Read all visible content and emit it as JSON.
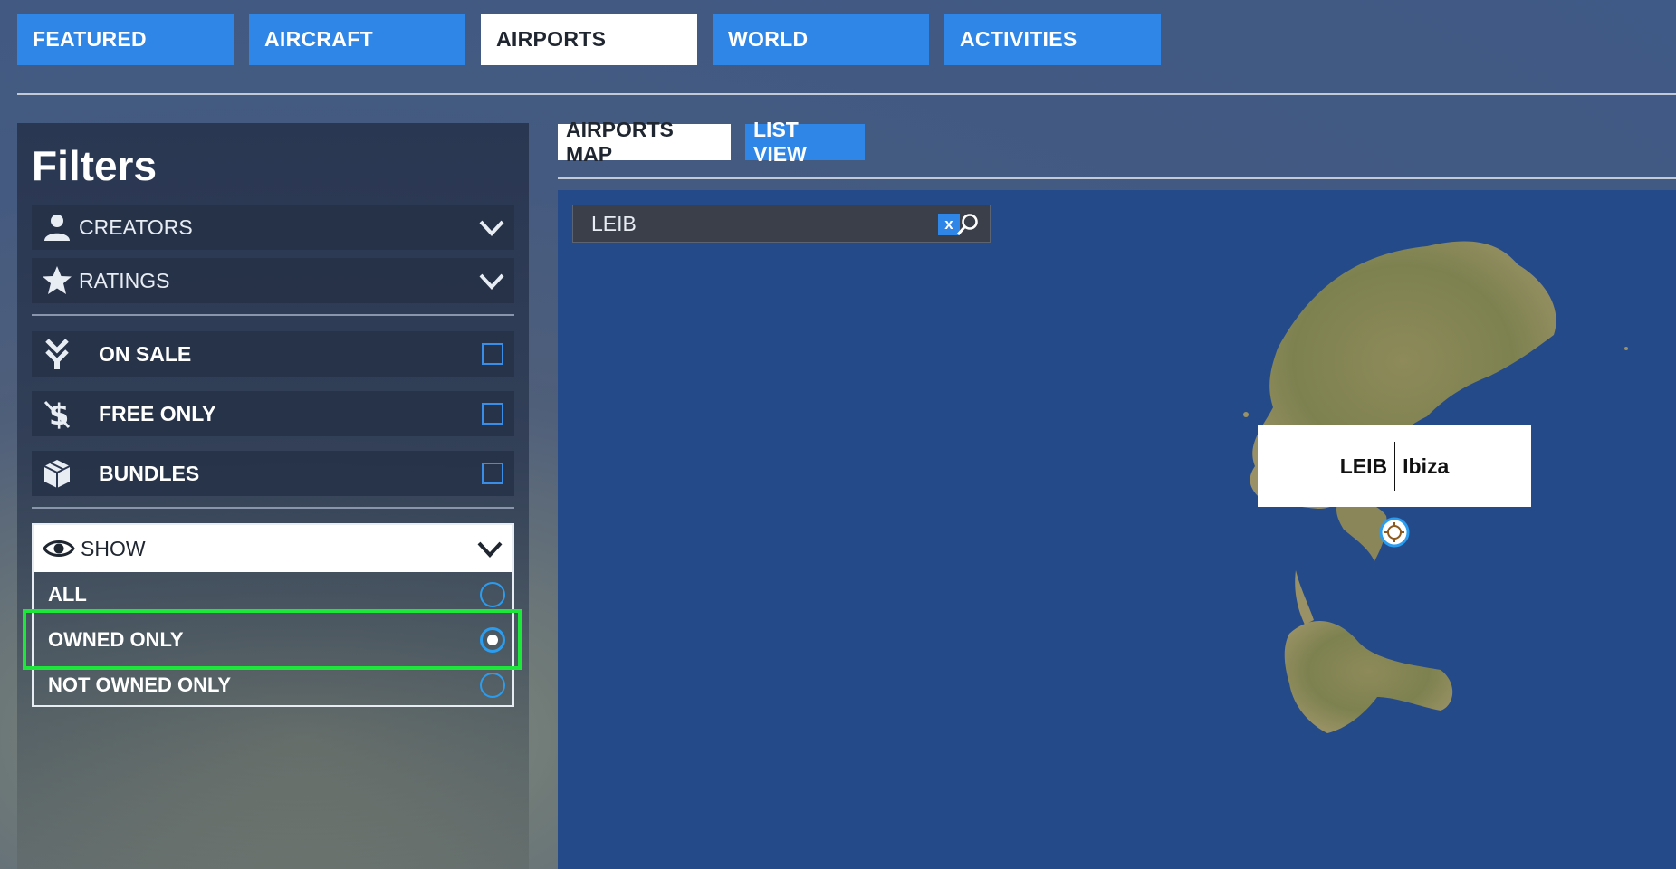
{
  "top_tabs": [
    {
      "label": "FEATURED"
    },
    {
      "label": "AIRCRAFT"
    },
    {
      "label": "AIRPORTS"
    },
    {
      "label": "WORLD"
    },
    {
      "label": "ACTIVITIES"
    }
  ],
  "active_top_tab": "AIRPORTS",
  "filters": {
    "title": "Filters",
    "creators_label": "CREATORS",
    "ratings_label": "RATINGS",
    "on_sale_label": "ON SALE",
    "free_only_label": "FREE ONLY",
    "bundles_label": "BUNDLES",
    "show": {
      "label": "SHOW",
      "options": [
        {
          "label": "ALL",
          "selected": false
        },
        {
          "label": "OWNED ONLY",
          "selected": true
        },
        {
          "label": "NOT OWNED ONLY",
          "selected": false
        }
      ]
    }
  },
  "view_tabs": {
    "map_label": "AIRPORTS MAP",
    "list_label": "LIST VIEW"
  },
  "search": {
    "value": "LEIB",
    "clear_label": "x"
  },
  "map_marker": {
    "code": "LEIB",
    "name": "Ibiza"
  },
  "colors": {
    "accent_blue": "#2f86e6",
    "highlight_green": "#1ee63a",
    "sea": "#254a8a"
  }
}
